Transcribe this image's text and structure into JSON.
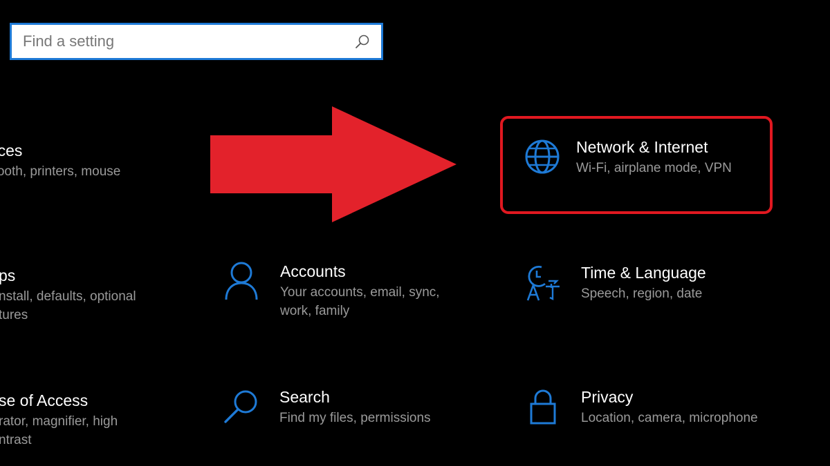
{
  "search": {
    "placeholder": "Find a setting"
  },
  "tiles": {
    "devices": {
      "title": "vices",
      "desc": "etooth, printers, mouse"
    },
    "network": {
      "title": "Network & Internet",
      "desc": "Wi-Fi, airplane mode, VPN"
    },
    "apps": {
      "title": "ps",
      "desc1": "nstall, defaults, optional",
      "desc2": "tures"
    },
    "accounts": {
      "title": "Accounts",
      "desc1": "Your accounts, email, sync,",
      "desc2": "work, family"
    },
    "time_language": {
      "title": "Time & Language",
      "desc": "Speech, region, date"
    },
    "ease_of_access": {
      "title": "se of Access",
      "desc1": "rator, magnifier, high",
      "desc2": "ntrast"
    },
    "search": {
      "title": "Search",
      "desc": "Find my files, permissions"
    },
    "privacy": {
      "title": "Privacy",
      "desc": "Location, camera, microphone"
    }
  },
  "icons": {
    "search": "search-icon",
    "network": "globe-icon",
    "accounts": "person-icon",
    "time_language": "clock-language-icon",
    "search_tile": "magnifier-icon",
    "privacy": "lock-icon"
  },
  "colors": {
    "background": "#000000",
    "accent": "#1e7ad6",
    "highlight": "#e01820",
    "title_text": "#ffffff",
    "desc_text": "#9a9a9a"
  }
}
